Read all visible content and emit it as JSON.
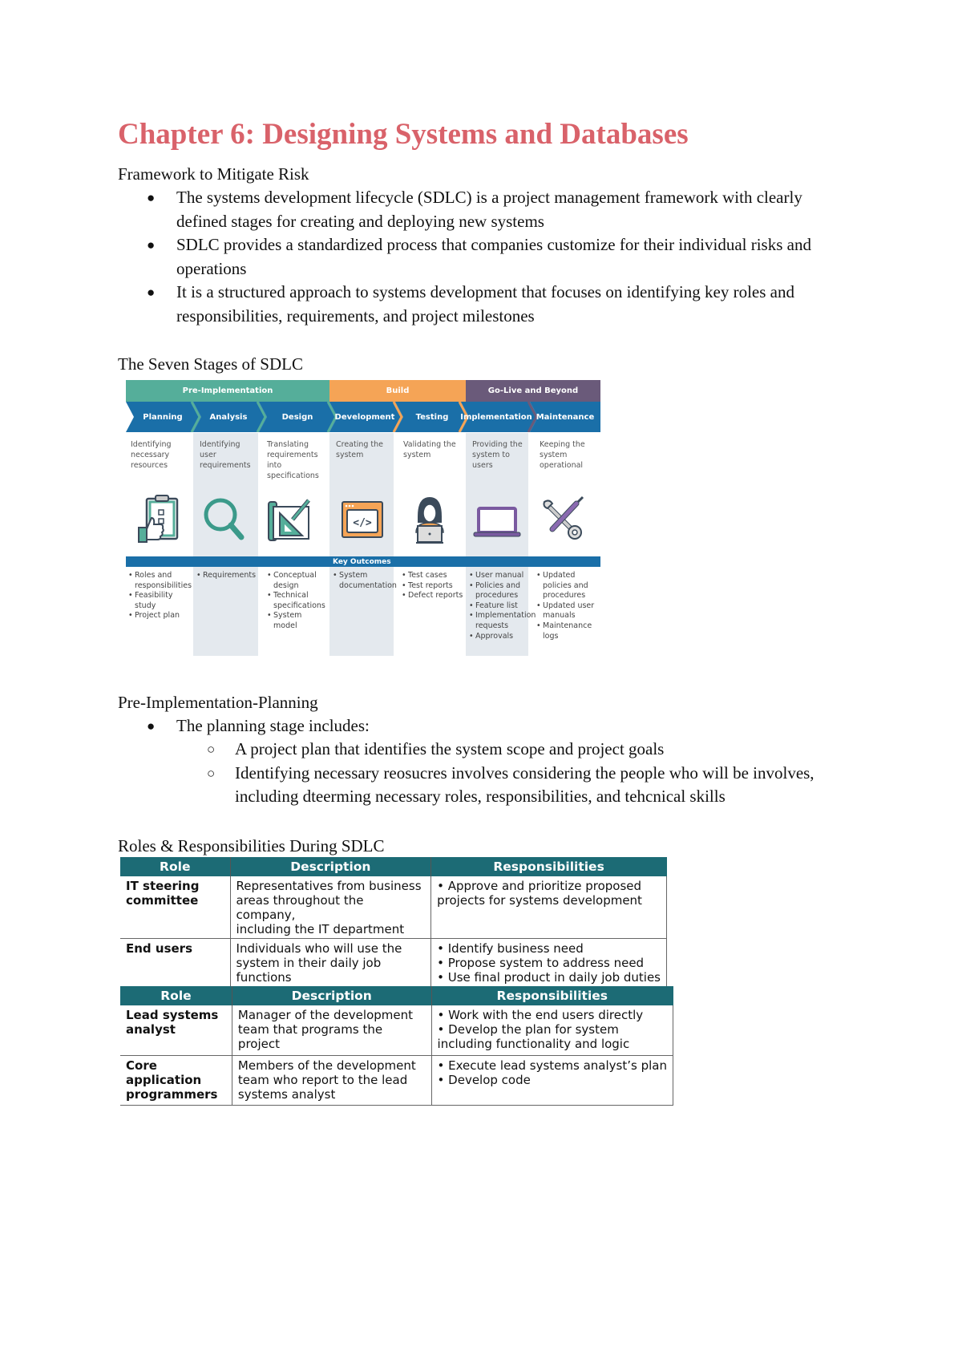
{
  "document": {
    "title": "Chapter 6: Designing Systems and Databases",
    "section1": {
      "heading": "Framework to Mitigate Risk",
      "bullets": [
        [
          "The systems development lifecycle (SDLC) is a project management framework with clearly",
          "defined stages for creating and deploying new systems"
        ],
        [
          "SDLC provides a standardized process that companies customize for their individual risks and",
          "operations"
        ],
        [
          "It is a structured approach to systems development that focuses on identifying key roles and",
          "responsibilities, requirements, and project milestones"
        ]
      ]
    },
    "section2": {
      "heading": "The Seven Stages of SDLC"
    },
    "section3": {
      "heading": "Pre-Implementation-Planning",
      "bullet": "The planning stage includes:",
      "sub_bullets": [
        [
          "A project plan that identifies the system scope and project goals"
        ],
        [
          "Identifying necessary reosucres involves considering the people who will be involves,",
          "including dteerming necessary roles, responsibilities, and tehcnical skills"
        ]
      ]
    },
    "section4": {
      "heading": "Roles & Responsibilities During SDLC"
    }
  },
  "sdlc_diagram": {
    "phases": [
      {
        "label": "Pre-Implementation",
        "color": "#55ae9a"
      },
      {
        "label": "Build",
        "color": "#f5a456"
      },
      {
        "label": "Go-Live and Beyond",
        "color": "#6a5a7a"
      }
    ],
    "stage_color": "#1a6fa8",
    "key_outcomes_label": "Key Outcomes",
    "stages": [
      {
        "name": "Planning",
        "desc": "Identifying\nnecessary\nresources",
        "icon": "clipboard-thumbs-up-icon",
        "outcomes": [
          "Roles and responsibilities",
          "Feasibility study",
          "Project plan"
        ]
      },
      {
        "name": "Analysis",
        "desc": "Identifying\nuser\nrequirements",
        "icon": "magnifying-glass-icon",
        "outcomes": [
          "Requirements"
        ]
      },
      {
        "name": "Design",
        "desc": "Translating\nrequirements\ninto\nspecifications",
        "icon": "blueprint-triangle-pencil-icon",
        "outcomes": [
          "Conceptual design",
          "Technical specifications",
          "System model"
        ]
      },
      {
        "name": "Development",
        "desc": "Creating the\nsystem",
        "icon": "code-window-icon",
        "outcomes": [
          "System documentation"
        ]
      },
      {
        "name": "Testing",
        "desc": "Validating the\nsystem",
        "icon": "person-laptop-icon",
        "outcomes": [
          "Test cases",
          "Test reports",
          "Defect reports"
        ]
      },
      {
        "name": "Implementation",
        "desc": "Providing the\nsystem to\nusers",
        "icon": "laptop-icon",
        "outcomes": [
          "User manual",
          "Policies and procedures",
          "Feature list",
          "Implementation requests",
          "Approvals"
        ]
      },
      {
        "name": "Maintenance",
        "desc": "Keeping the\nsystem\noperational",
        "icon": "wrench-screwdriver-icon",
        "outcomes": [
          "Updated policies and procedures",
          "Updated user manuals",
          "Maintenance logs"
        ]
      }
    ]
  },
  "tables": [
    {
      "headers": [
        "Role",
        "Description",
        "Responsibilities"
      ],
      "rows": [
        {
          "role": [
            "IT steering",
            "committee"
          ],
          "description": [
            "Representatives from business",
            "areas throughout the company,",
            "including the IT department"
          ],
          "responsibilities": [
            "• Approve and prioritize proposed",
            "projects for systems development"
          ]
        },
        {
          "role": [
            "End users"
          ],
          "description": [
            "Individuals who will use the",
            "system in their daily job",
            "functions"
          ],
          "responsibilities": [
            "• Identify business need",
            "• Propose system to address need",
            "• Use final product in daily job duties"
          ]
        }
      ]
    },
    {
      "headers": [
        "Role",
        "Description",
        "Responsibilities"
      ],
      "rows": [
        {
          "role": [
            "Lead systems",
            "analyst"
          ],
          "description": [
            "Manager of the development",
            "team that programs the project"
          ],
          "responsibilities": [
            "• Work with the end users directly",
            "• Develop the plan for system",
            "including functionality and logic"
          ]
        },
        {
          "role": [
            "Core application",
            "programmers"
          ],
          "description": [
            "Members of the development",
            "team who report to the lead",
            "systems analyst"
          ],
          "responsibilities": [
            "• Execute lead systems analyst’s plan",
            "• Develop code"
          ]
        }
      ]
    }
  ]
}
